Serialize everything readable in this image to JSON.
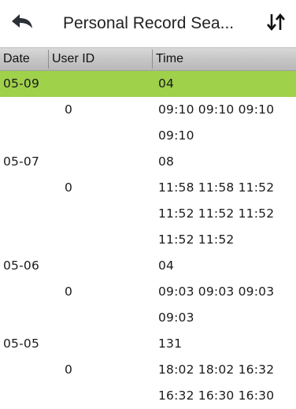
{
  "header": {
    "title": "Personal Record Sea...",
    "back_icon": "back-arrow-icon",
    "sort_icon": "sort-arrows-icon"
  },
  "columns": {
    "date": "Date",
    "user_id": "User ID",
    "time": "Time"
  },
  "rows": [
    {
      "date": "05-09",
      "user_id": "",
      "time": "04",
      "selected": true
    },
    {
      "date": "",
      "user_id": "0",
      "time": "09:10 09:10 09:10"
    },
    {
      "date": "",
      "user_id": "",
      "time": "09:10"
    },
    {
      "date": "05-07",
      "user_id": "",
      "time": "08"
    },
    {
      "date": "",
      "user_id": "0",
      "time": "11:58 11:58 11:52"
    },
    {
      "date": "",
      "user_id": "",
      "time": "11:52 11:52 11:52"
    },
    {
      "date": "",
      "user_id": "",
      "time": "11:52 11:52"
    },
    {
      "date": "05-06",
      "user_id": "",
      "time": "04"
    },
    {
      "date": "",
      "user_id": "0",
      "time": "09:03 09:03 09:03"
    },
    {
      "date": "",
      "user_id": "",
      "time": "09:03"
    },
    {
      "date": "05-05",
      "user_id": "",
      "time": "131"
    },
    {
      "date": "",
      "user_id": "0",
      "time": "18:02 18:02 16:32"
    },
    {
      "date": "",
      "user_id": "",
      "time": "16:32 16:30 16:30"
    }
  ],
  "colors": {
    "selected_row": "#9fd14a",
    "header_gray": "#c6c6c6"
  }
}
